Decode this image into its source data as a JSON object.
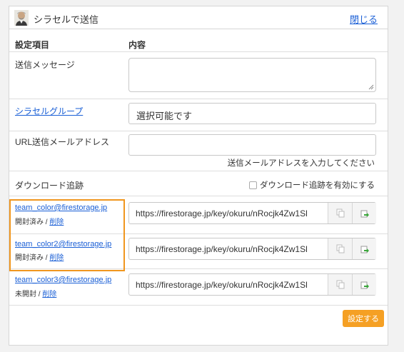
{
  "header": {
    "title": "シラセルで送信",
    "close_label": "閉じる"
  },
  "table": {
    "col_setting": "設定項目",
    "col_content": "内容"
  },
  "rows": {
    "message_label": "送信メッセージ",
    "message_value": "",
    "group_label": "シラセルグループ",
    "group_value": "選択可能です",
    "url_email_label": "URL送信メールアドレス",
    "url_email_value": "",
    "url_email_hint": "送信メールアドレスを入力してください",
    "tracking_label": "ダウンロード追跡",
    "tracking_checkbox_label": "ダウンロード追跡を有効にする"
  },
  "recipients": [
    {
      "email": "team_color@firestorage.jp",
      "status": "開封済み",
      "delete": "削除",
      "url": "https://firestorage.jp/key/okuru/nRocjk4Zw1Sl"
    },
    {
      "email": "team_color2@firestorage.jp",
      "status": "開封済み",
      "delete": "削除",
      "url": "https://firestorage.jp/key/okuru/nRocjk4Zw1Sl"
    },
    {
      "email": "team_color3@firestorage.jp",
      "status": "未開封",
      "delete": "削除",
      "url": "https://firestorage.jp/key/okuru/nRocjk4Zw1Sl"
    }
  ],
  "separator": " / ",
  "submit_label": "設定する",
  "colors": {
    "accent": "#f5a024",
    "link": "#1a5fd6",
    "highlight": "#f0961e"
  },
  "icons": {
    "avatar": "avatar-icon",
    "copy": "copy-icon",
    "open": "open-link-icon"
  }
}
